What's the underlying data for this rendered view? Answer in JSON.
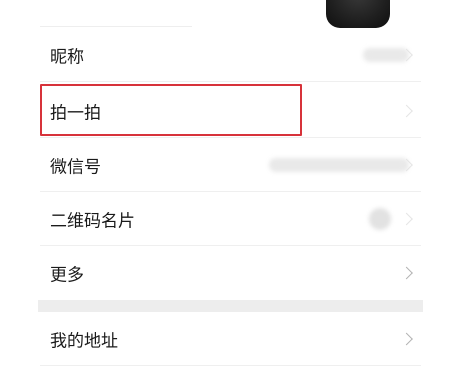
{
  "profile": {
    "items": [
      {
        "label": "昵称"
      },
      {
        "label": "拍一拍"
      },
      {
        "label": "微信号"
      },
      {
        "label": "二维码名片"
      },
      {
        "label": "更多"
      }
    ],
    "section2": {
      "items": [
        {
          "label": "我的地址"
        }
      ]
    }
  },
  "colors": {
    "highlight_border": "#d7323a",
    "text": "#1a1a1a",
    "chevron": "#b3b3b3",
    "section_gap": "#ededed"
  },
  "icons": [
    "chevron-right-icon",
    "qr-code-icon",
    "avatar"
  ]
}
